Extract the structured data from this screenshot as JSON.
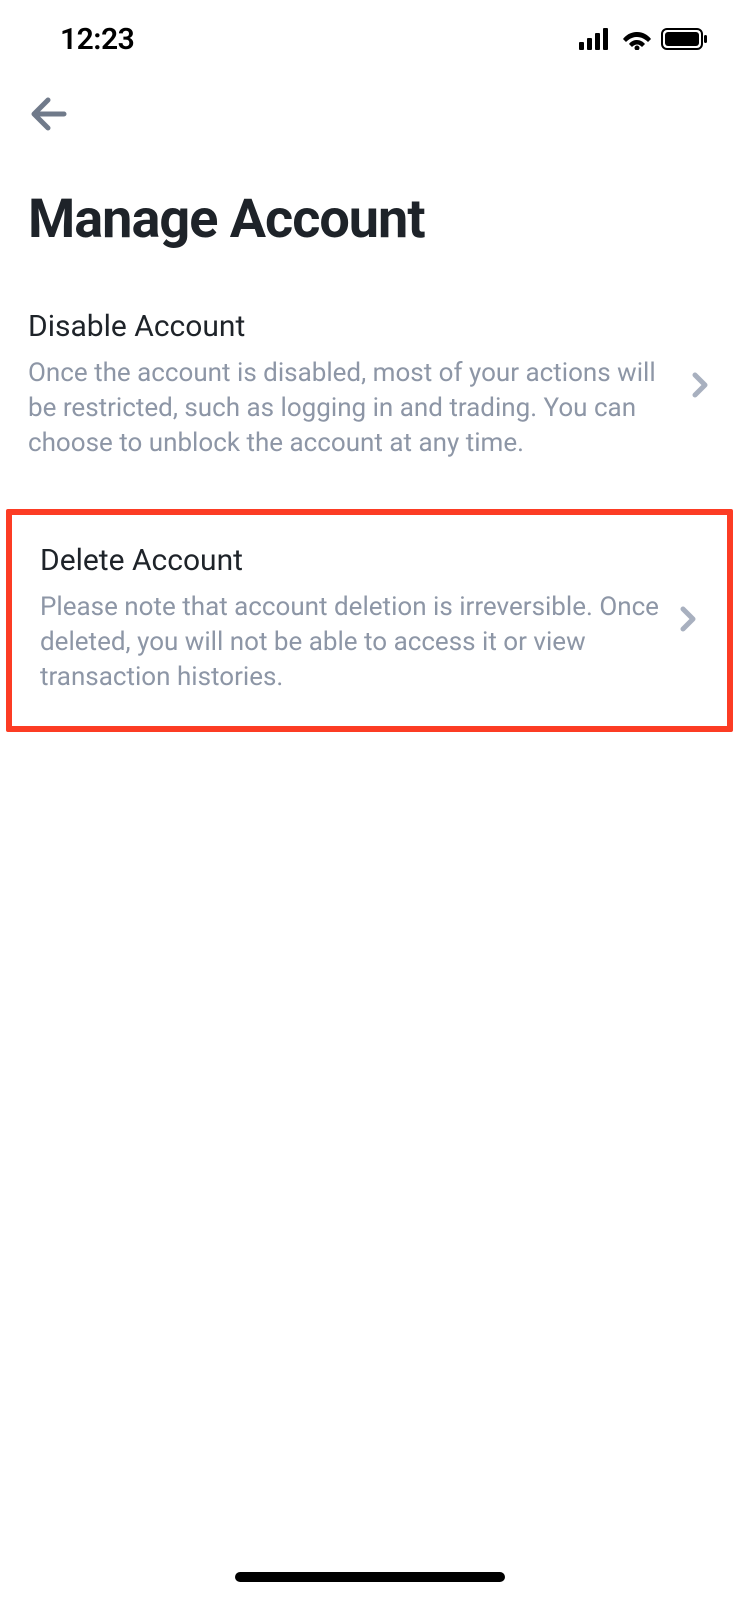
{
  "statusBar": {
    "time": "12:23"
  },
  "page": {
    "title": "Manage Account"
  },
  "items": [
    {
      "title": "Disable Account",
      "description": "Once the account is disabled, most of your actions will be restricted, such as logging in and trading. You can choose to unblock the account at any time."
    },
    {
      "title": "Delete Account",
      "description": "Please note that account deletion is irreversible. Once deleted, you will not be able to access it or view transaction histories."
    }
  ]
}
